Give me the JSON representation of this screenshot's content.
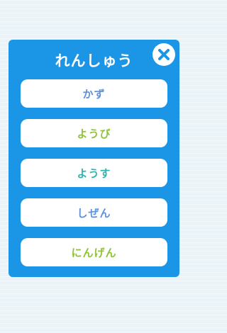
{
  "dialog": {
    "title": "れんしゅう",
    "options": [
      {
        "label": "かず",
        "color": "#5f92d8"
      },
      {
        "label": "ようび",
        "color": "#8fc23a"
      },
      {
        "label": "ようす",
        "color": "#2fb3b0"
      },
      {
        "label": "しぜん",
        "color": "#5f92d8"
      },
      {
        "label": "にんげん",
        "color": "#8fc23a"
      }
    ],
    "close_icon": "close-icon",
    "colors": {
      "panel": "#1b95e6",
      "background": "#eaf3f8",
      "close_x": "#1b95e6"
    }
  }
}
